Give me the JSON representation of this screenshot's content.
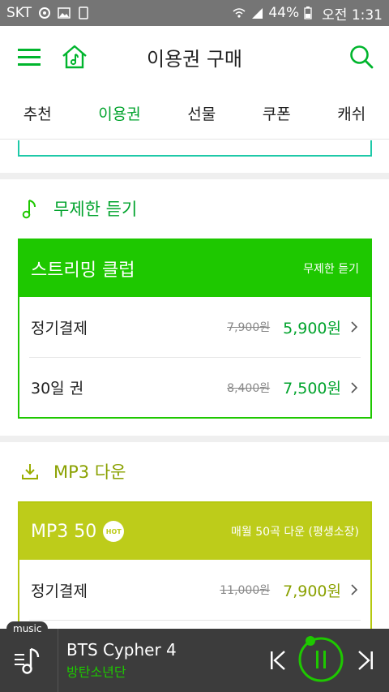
{
  "status_bar": {
    "carrier": "SKT",
    "battery": "44%",
    "time": "오전 1:31"
  },
  "app_bar": {
    "title": "이용권 구매"
  },
  "tabs": [
    {
      "label": "추천"
    },
    {
      "label": "이용권"
    },
    {
      "label": "선물"
    },
    {
      "label": "쿠폰"
    },
    {
      "label": "캐쉬"
    }
  ],
  "active_tab": "이용권",
  "sections": [
    {
      "title": "무제한 듣기",
      "icon": "music-note-icon",
      "color": "#1ec800",
      "card": {
        "name": "스트리밍 클럽",
        "desc": "무제한 듣기",
        "rows": [
          {
            "label": "정기결제",
            "old_price": "7,900원",
            "price": "5,900원"
          },
          {
            "label": "30일 권",
            "old_price": "8,400원",
            "price": "7,500원"
          }
        ]
      }
    },
    {
      "title": "MP3 다운",
      "icon": "download-icon",
      "color": "#b5c90f",
      "card": {
        "name": "MP3 50",
        "badge": "HOT",
        "desc": "매월 50곡 다운 (평생소장)",
        "rows": [
          {
            "label": "정기결제",
            "old_price": "11,000원",
            "price": "7,900원"
          }
        ]
      }
    }
  ],
  "player": {
    "tag": "music",
    "song": "BTS Cypher 4",
    "artist": "방탄소년단",
    "accent": "#1ec800"
  }
}
